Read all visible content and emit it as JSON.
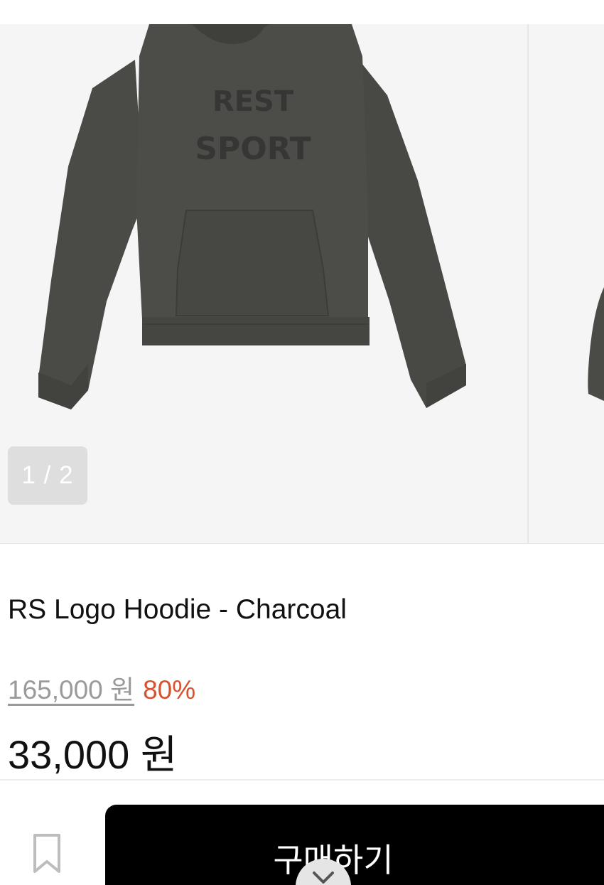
{
  "gallery": {
    "counter": "1 / 2",
    "current_slide": 1,
    "total_slides": 2,
    "main_image_alt": "RS Logo Hoodie - Charcoal",
    "print_line1": "REST",
    "print_line2": "SPORT",
    "colors": {
      "background": "#f5f5f5",
      "hoodie": "#4a4a47",
      "print": "#363634"
    }
  },
  "product": {
    "title": "RS Logo Hoodie - Charcoal",
    "original_price": "165,000 원",
    "discount": "80%",
    "price": "33,000 원"
  },
  "actions": {
    "buy_label": "구매하기",
    "bookmark_icon": "bookmark-icon",
    "close_icon": "chevron-down-icon"
  },
  "colors": {
    "discount": "#d9502e",
    "buy_button": "#000000",
    "muted_text": "#9a9a9a"
  }
}
